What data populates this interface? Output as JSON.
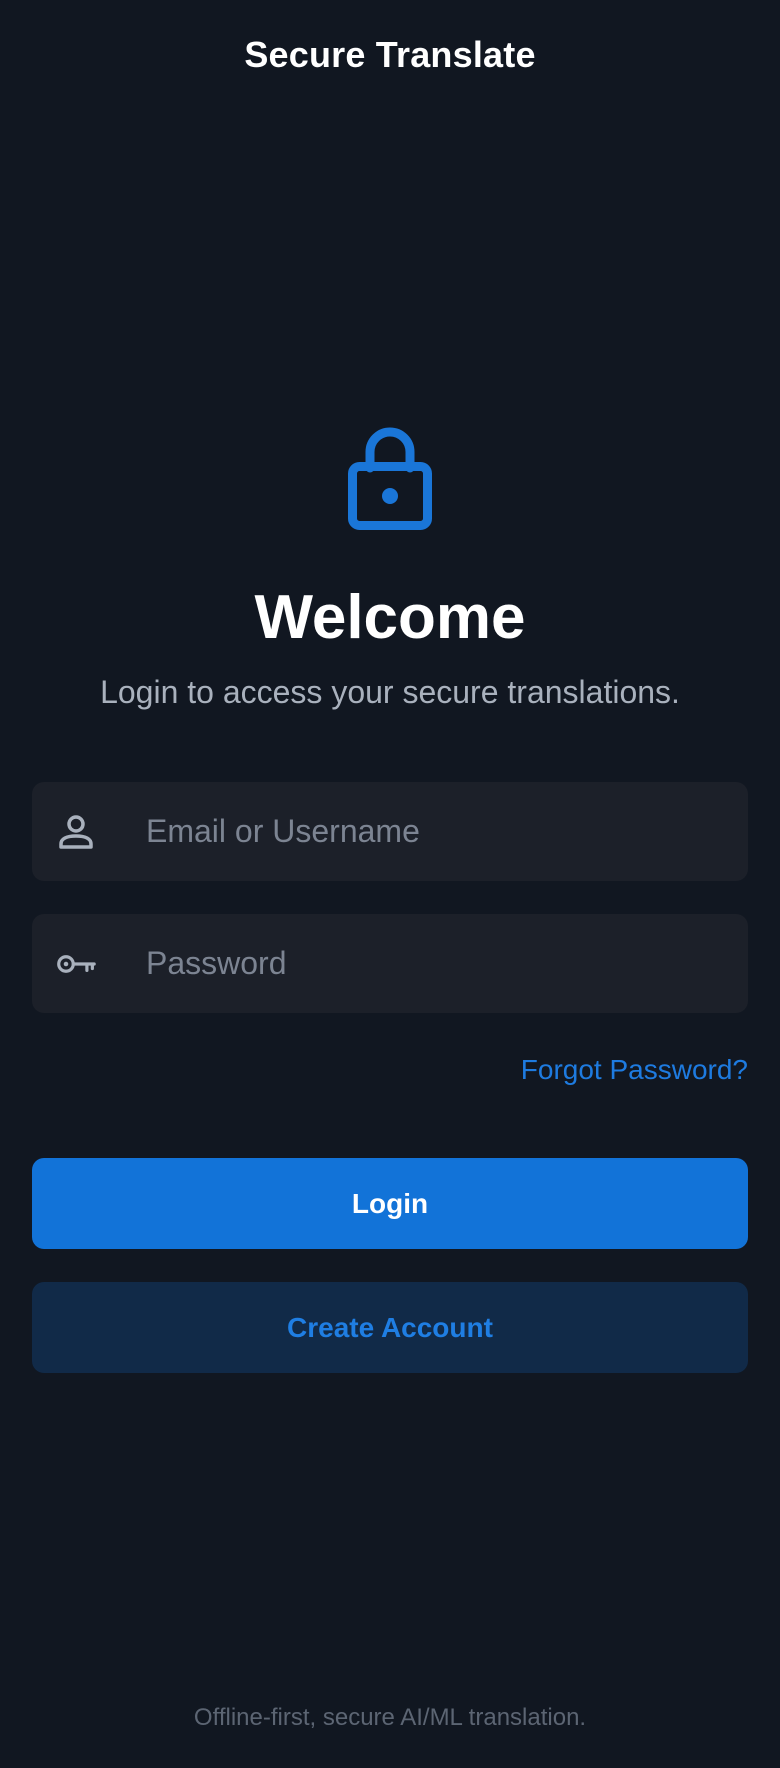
{
  "header": {
    "title": "Secure Translate"
  },
  "hero": {
    "icon": "lock-icon",
    "title": "Welcome",
    "subtitle": "Login to access your secure translations."
  },
  "form": {
    "email": {
      "icon": "user-icon",
      "placeholder": "Email or Username",
      "value": ""
    },
    "password": {
      "icon": "key-icon",
      "placeholder": "Password",
      "value": ""
    },
    "forgot_label": "Forgot Password?",
    "login_label": "Login",
    "create_label": "Create Account"
  },
  "footer": {
    "text": "Offline-first, secure AI/ML translation."
  },
  "colors": {
    "background": "#111721",
    "field_bg": "#1c2029",
    "accent": "#1273d8",
    "secondary_button_bg": "#112a48",
    "link": "#1e7be0"
  }
}
